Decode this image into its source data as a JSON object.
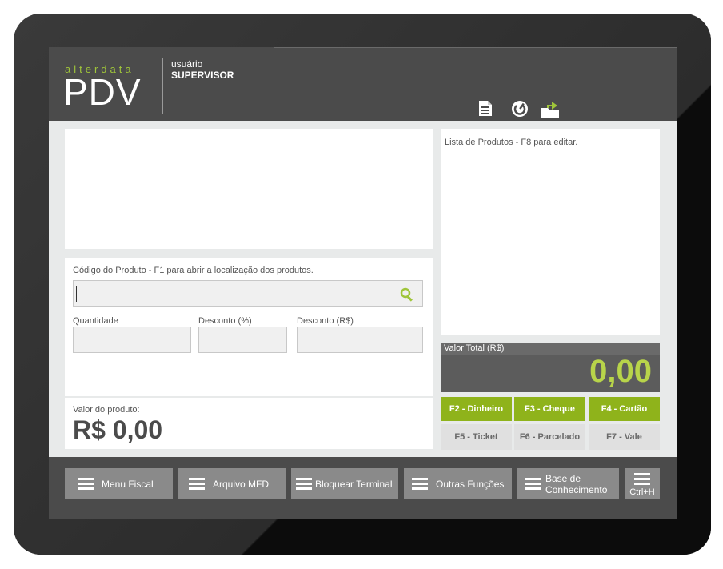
{
  "header": {
    "brand_small": "alterdata",
    "brand_big": "PDV",
    "user_label": "usuário",
    "user_name": "SUPERVISOR",
    "icons": [
      "document-icon",
      "power-icon",
      "export-icon"
    ]
  },
  "product_code": {
    "label": "Código do Produto - F1 para abrir a localização dos produtos.",
    "value": ""
  },
  "fields": {
    "quantity_label": "Quantidade",
    "discount_pct_label": "Desconto (%)",
    "discount_value_label": "Desconto (R$)"
  },
  "product_value": {
    "label": "Valor do produto:",
    "value": "R$ 0,00"
  },
  "product_list": {
    "label": "Lista de Produtos - F8 para editar."
  },
  "total": {
    "label": "Valor Total (R$)",
    "value": "0,00"
  },
  "payment": {
    "cash": "F2 - Dinheiro",
    "check": "F3 - Cheque",
    "card": "F4 - Cartão",
    "ticket": "F5 - Ticket",
    "installments": "F6 - Parcelado",
    "voucher": "F7 - Vale"
  },
  "footer": {
    "fiscal_menu": "Menu Fiscal",
    "mfd_file": "Arquivo MFD",
    "lock_terminal": "Bloquear Terminal",
    "other_functions": "Outras Funções",
    "knowledge_base_line1": "Base de",
    "knowledge_base_line2": "Conhecimento",
    "shortcut": "Ctrl+H"
  },
  "colors": {
    "accent": "#8fb31b",
    "header_bg": "#4b4b4b",
    "total_value": "#b8d44a"
  }
}
